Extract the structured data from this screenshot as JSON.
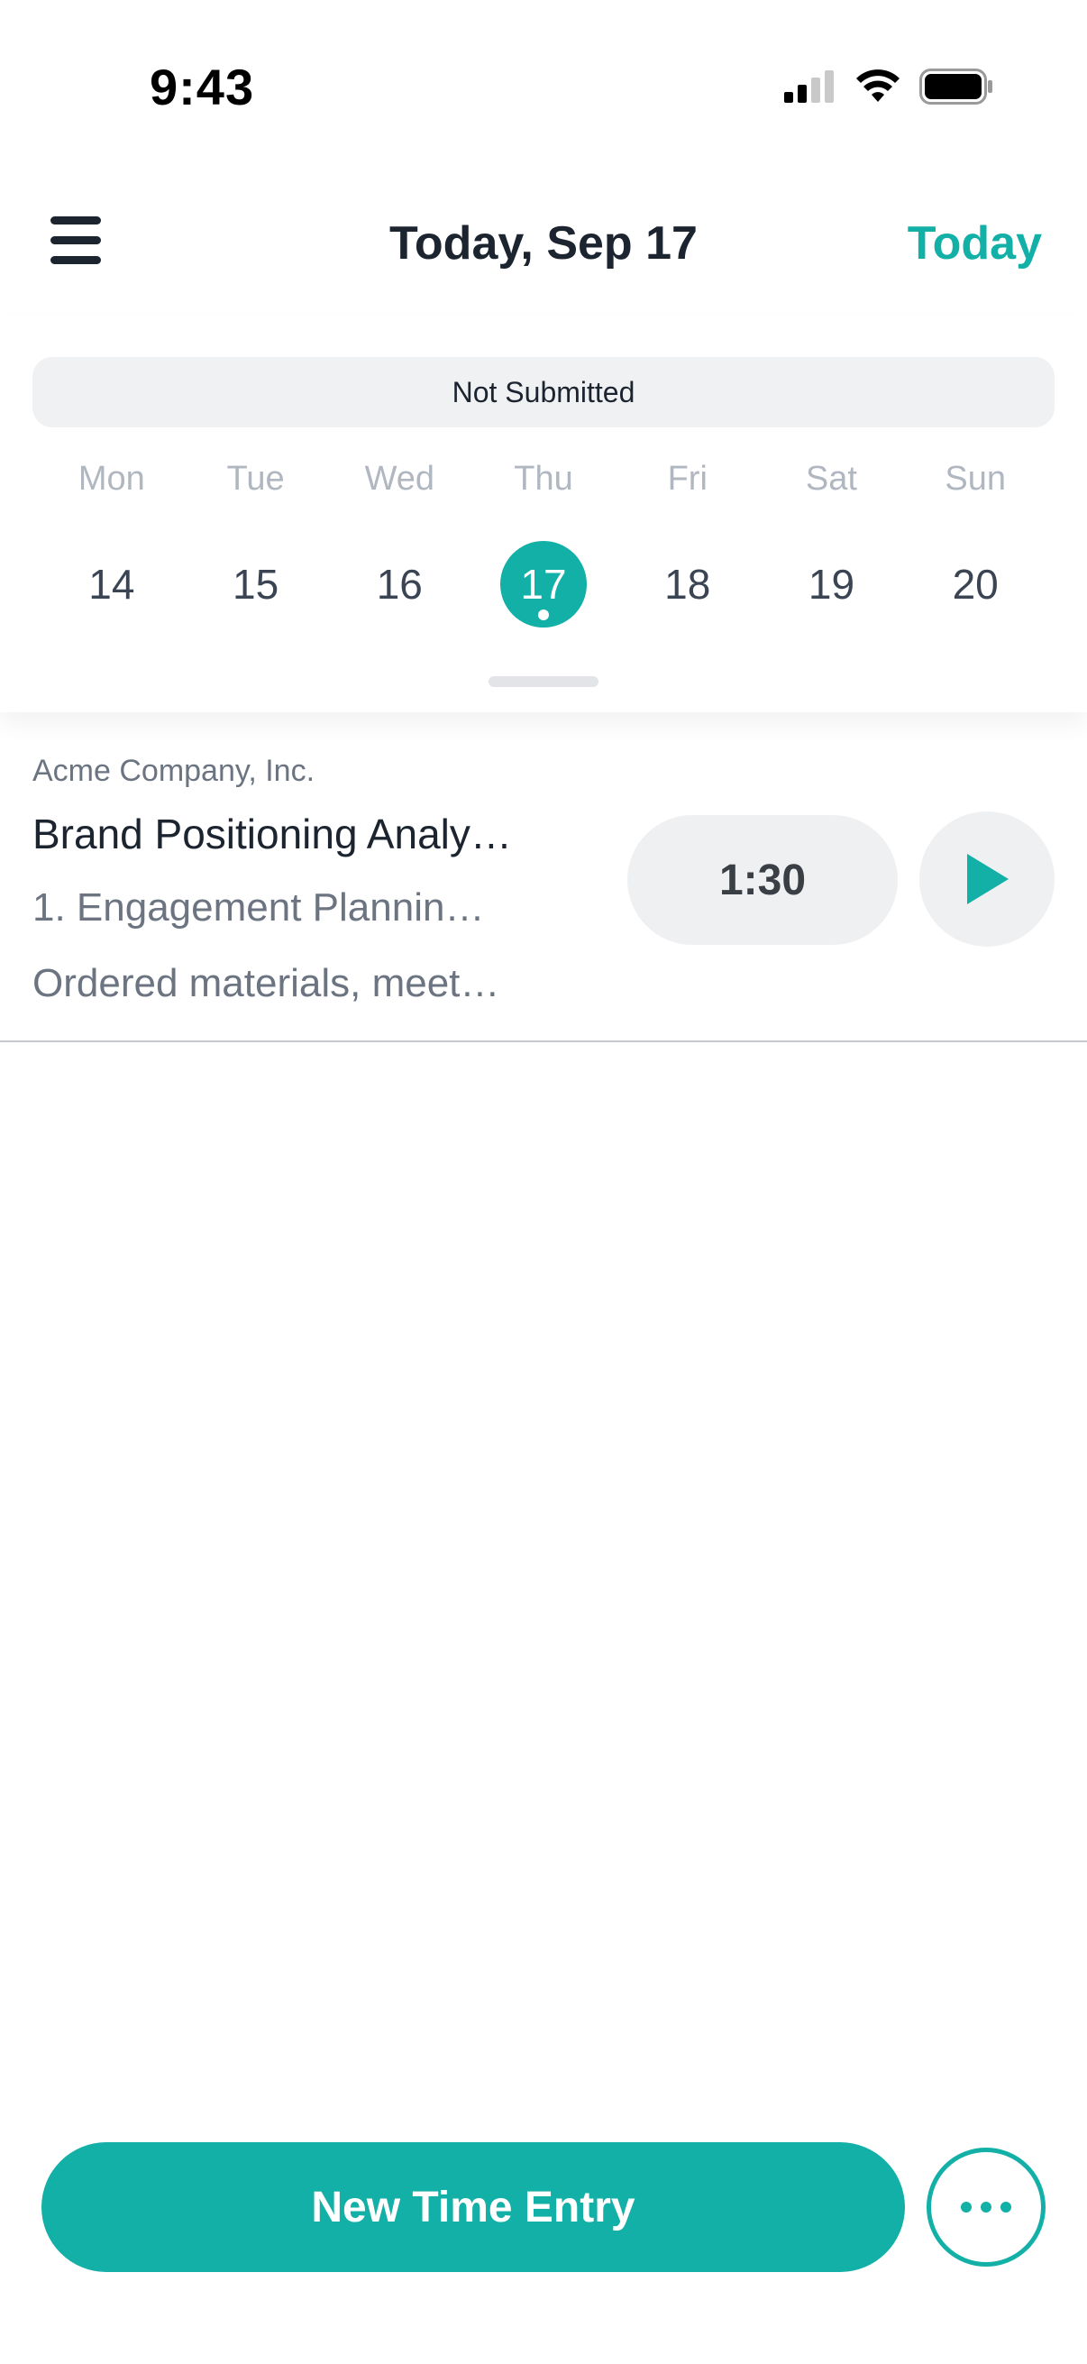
{
  "status_bar": {
    "time": "9:43"
  },
  "header": {
    "title": "Today, Sep 17",
    "today_label": "Today"
  },
  "week": {
    "status": "Not Submitted",
    "days": [
      {
        "name": "Mon",
        "num": "14"
      },
      {
        "name": "Tue",
        "num": "15"
      },
      {
        "name": "Wed",
        "num": "16"
      },
      {
        "name": "Thu",
        "num": "17"
      },
      {
        "name": "Fri",
        "num": "18"
      },
      {
        "name": "Sat",
        "num": "19"
      },
      {
        "name": "Sun",
        "num": "20"
      }
    ],
    "selected_day": "17"
  },
  "entries": [
    {
      "client": "Acme Company, Inc.",
      "project": "Brand Positioning Analy…",
      "task": "1. Engagement Plannin…",
      "notes": "Ordered materials, meet…",
      "duration": "1:30"
    }
  ],
  "actions": {
    "new_entry_label": "New Time Entry"
  },
  "colors": {
    "accent": "#12b0a6",
    "text_primary": "#1c2430",
    "text_secondary": "#6b7480"
  },
  "icons": {
    "menu": "hamburger-menu-icon",
    "play": "play-icon",
    "more": "more-horizontal-icon"
  }
}
